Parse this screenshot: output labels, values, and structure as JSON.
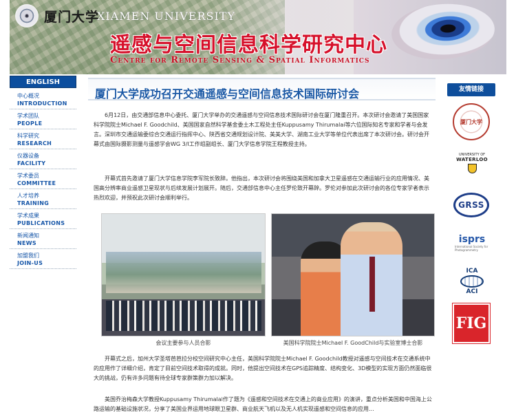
{
  "banner": {
    "cn_university": "厦门大学",
    "en_university": "XIAMEN UNIVERSITY",
    "title_cn": "遥感与空间信息科学研究中心",
    "title_en": "Centre for Remote Sensing & Spatial Informatics"
  },
  "nav": {
    "english_label": "ENGLISH",
    "items": [
      {
        "cn": "中心概况",
        "en": "INTRODUCTION"
      },
      {
        "cn": "学术团队",
        "en": "PEOPLE"
      },
      {
        "cn": "科学研究",
        "en": "RESEARCH"
      },
      {
        "cn": "仪器设备",
        "en": "FACILITY"
      },
      {
        "cn": "学术委员",
        "en": "COMMITTEE"
      },
      {
        "cn": "人才培养",
        "en": "TRAINING"
      },
      {
        "cn": "学术成果",
        "en": "PUBLICATIONS"
      },
      {
        "cn": "新闻通知",
        "en": "NEWS"
      },
      {
        "cn": "加盟我们",
        "en": "JOIN-US"
      }
    ]
  },
  "article": {
    "title": "厦门大学成功召开交通遥感与空间信息技术国际研讨会",
    "p1": "6月12日，由交通部信息中心委托、厦门大学举办的交通遥感与空间信息技术国际研讨会在厦门隆重召开。本次研讨会邀请了美国国家科学院院士Michael F. Goodchild、美国国家自然科学基金委土木工程处主任Kuppusamy Thirumalai等六位国际知名专家和学者与会发言。深圳市交通运输委综合交通运行指挥中心、陕西省交通规划设计院、美美大学、湖南工业大学等单位代表出席了本次研讨会。研讨会开幕式由国际摄影测量与遥感学会WG 3/I工作组副组长、厦门大学信息学院王程教授主持。",
    "p2": "开幕式首先邀请了厦门大学信息学院李军院长致辞。他指出，本次研讨会将围绕美国和加拿大卫星遥感在交通运输行业的应用情况、美国高分辨率商业遥感卫星现状与后续发展计划展开。随后，交通部信息中心主任罗伦致开幕辞。罗伦对参加此次研讨会的各位专家学者表示热烈欢迎，并预祝此次研讨会顺利举行。",
    "caption1": "会议主要参与人员合影",
    "caption2": "美国科学院院士Michael F. GoodChild与实验室博士合影",
    "p3": "开幕式之后，加州大学圣塔芭芭拉分校空间研究中心主任，美国科学院院士Michael F. Goodchild教授对遥感与空间技术在交通系统中的应用作了详细介绍，肯定了目前空间技术取得的成就。同时，他提出空间技术在GPS追踪精度、结构变化、3D模型的实现方面仍然面临很大的挑战，仍有许多问题有待全球专家群策群力加以解决。",
    "p4": "美国乔治梅森大学教授Kuppusamy Thirumalai作了题为《遥感和空间技术在交通上的商业应用》的演讲，重点分析美国和中国海上公路运输的基础设施状况，分享了美国业界运用地球眼卫星群、商业航天飞机以及无人机实现遥感和空间信息的应用..."
  },
  "sidebar": {
    "heading": "友情链接",
    "logos": {
      "xmu": "厦门大学",
      "waterloo_top": "UNIVERSITY OF",
      "waterloo": "WATERLOO",
      "grss": "GRSS",
      "isprs": "isprs",
      "isprs_sub": "International Society for Photogrammetry",
      "ica_top": "ICA",
      "ica_bottom": "ACI",
      "fig": "FIG"
    }
  },
  "colors": {
    "nav_blue": "#0c4e9e",
    "title_red": "#d6102a",
    "heading_blue": "#1a58a5"
  }
}
